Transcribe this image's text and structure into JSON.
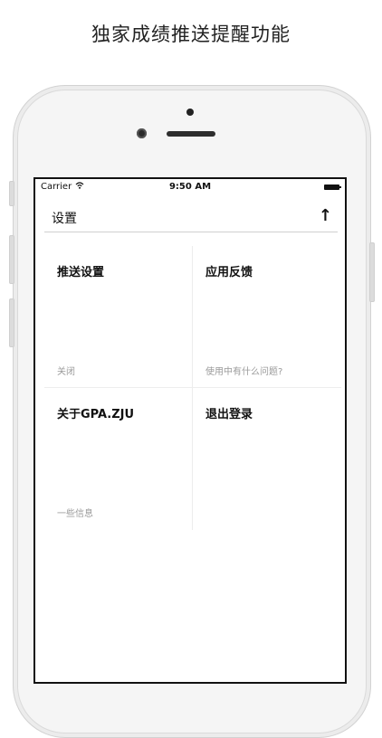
{
  "headline": "独家成绩推送提醒功能",
  "status": {
    "carrier": "Carrier",
    "time": "9:50 AM"
  },
  "nav": {
    "title": "设置",
    "up_glyph": "↑"
  },
  "tiles": [
    {
      "title": "推送设置",
      "subtitle": "关闭"
    },
    {
      "title": "应用反馈",
      "subtitle": "使用中有什么问题?"
    },
    {
      "title": "关于GPA.ZJU",
      "subtitle": "一些信息"
    },
    {
      "title": "退出登录",
      "subtitle": ""
    }
  ]
}
